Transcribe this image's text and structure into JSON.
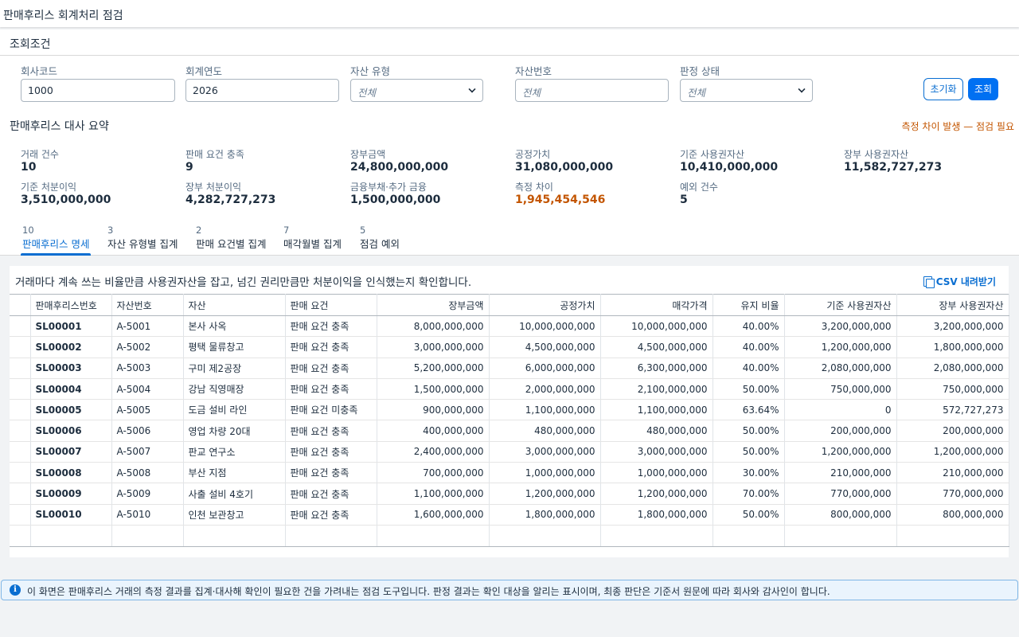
{
  "app": {
    "title": "판매후리스 회계처리 점검"
  },
  "filters": {
    "section_title": "조회조건",
    "company_code": {
      "label": "회사코드",
      "value": "1000"
    },
    "fiscal_year": {
      "label": "회계연도",
      "value": "2026"
    },
    "asset_type": {
      "label": "자산 유형",
      "value": "전체"
    },
    "asset_no": {
      "label": "자산번호",
      "placeholder": "전체"
    },
    "judgement": {
      "label": "판정 상태",
      "value": "전체"
    },
    "reset_label": "초기화",
    "search_label": "조회"
  },
  "summary": {
    "title": "판매후리스 대사 요약",
    "alert": "측정 차이 발생 — 점검 필요",
    "kpis": {
      "tx_count": {
        "label": "거래 건수",
        "value": "10"
      },
      "sale_met": {
        "label": "판매 요건 충족",
        "value": "9"
      },
      "carrying": {
        "label": "장부금액",
        "value": "24,800,000,000"
      },
      "fair_value": {
        "label": "공정가치",
        "value": "31,080,000,000"
      },
      "ref_rou": {
        "label": "기준 사용권자산",
        "value": "10,410,000,000"
      },
      "book_rou": {
        "label": "장부 사용권자산",
        "value": "11,582,727,273"
      },
      "ref_gain": {
        "label": "기준 처분이익",
        "value": "3,510,000,000"
      },
      "book_gain": {
        "label": "장부 처분이익",
        "value": "4,282,727,273"
      },
      "fin_liab": {
        "label": "금융부채·추가 금융",
        "value": "1,500,000,000"
      },
      "diff": {
        "label": "측정 차이",
        "value": "1,945,454,546"
      },
      "exceptions": {
        "label": "예외 건수",
        "value": "5"
      }
    }
  },
  "tabs": [
    {
      "count": "10",
      "label": "판매후리스 명세"
    },
    {
      "count": "3",
      "label": "자산 유형별 집계"
    },
    {
      "count": "2",
      "label": "판매 요건별 집계"
    },
    {
      "count": "7",
      "label": "매각월별 집계"
    },
    {
      "count": "5",
      "label": "점검 예외"
    }
  ],
  "table": {
    "caption": "거래마다 계속 쓰는 비율만큼 사용권자산을 잡고, 넘긴 권리만큼만 처분이익을 인식했는지 확인합니다.",
    "csv_label": "CSV 내려받기",
    "columns": [
      "판매후리스번호",
      "자산번호",
      "자산",
      "판매 요건",
      "장부금액",
      "공정가치",
      "매각가격",
      "유지 비율",
      "기준 사용권자산",
      "장부 사용권자산"
    ],
    "rows": [
      [
        "SL00001",
        "A-5001",
        "본사 사옥",
        "판매 요건 충족",
        "8,000,000,000",
        "10,000,000,000",
        "10,000,000,000",
        "40.00%",
        "3,200,000,000",
        "3,200,000,000"
      ],
      [
        "SL00002",
        "A-5002",
        "평택 물류창고",
        "판매 요건 충족",
        "3,000,000,000",
        "4,500,000,000",
        "4,500,000,000",
        "40.00%",
        "1,200,000,000",
        "1,800,000,000"
      ],
      [
        "SL00003",
        "A-5003",
        "구미 제2공장",
        "판매 요건 충족",
        "5,200,000,000",
        "6,000,000,000",
        "6,300,000,000",
        "40.00%",
        "2,080,000,000",
        "2,080,000,000"
      ],
      [
        "SL00004",
        "A-5004",
        "강남 직영매장",
        "판매 요건 충족",
        "1,500,000,000",
        "2,000,000,000",
        "2,100,000,000",
        "50.00%",
        "750,000,000",
        "750,000,000"
      ],
      [
        "SL00005",
        "A-5005",
        "도금 설비 라인",
        "판매 요건 미충족",
        "900,000,000",
        "1,100,000,000",
        "1,100,000,000",
        "63.64%",
        "0",
        "572,727,273"
      ],
      [
        "SL00006",
        "A-5006",
        "영업 차량 20대",
        "판매 요건 충족",
        "400,000,000",
        "480,000,000",
        "480,000,000",
        "50.00%",
        "200,000,000",
        "200,000,000"
      ],
      [
        "SL00007",
        "A-5007",
        "판교 연구소",
        "판매 요건 충족",
        "2,400,000,000",
        "3,000,000,000",
        "3,000,000,000",
        "50.00%",
        "1,200,000,000",
        "1,200,000,000"
      ],
      [
        "SL00008",
        "A-5008",
        "부산 지점",
        "판매 요건 충족",
        "700,000,000",
        "1,000,000,000",
        "1,000,000,000",
        "30.00%",
        "210,000,000",
        "210,000,000"
      ],
      [
        "SL00009",
        "A-5009",
        "사출 설비 4호기",
        "판매 요건 충족",
        "1,100,000,000",
        "1,200,000,000",
        "1,200,000,000",
        "70.00%",
        "770,000,000",
        "770,000,000"
      ],
      [
        "SL00010",
        "A-5010",
        "인천 보관창고",
        "판매 요건 충족",
        "1,600,000,000",
        "1,800,000,000",
        "1,800,000,000",
        "50.00%",
        "800,000,000",
        "800,000,000"
      ]
    ]
  },
  "footer": {
    "note": "이 화면은 판매후리스 거래의 측정 결과를 집계·대사해 확인이 필요한 건을 가려내는 점검 도구입니다. 판정 결과는 확인 대상을 알리는 표시이며, 최종 판단은 기준서 원문에 따라 회사와 감사인이 합니다."
  },
  "colors": {
    "accent": "#0a6ed1",
    "warning": "#c35500"
  },
  "icons": {
    "csv": "copy-icon",
    "info": "info-icon",
    "dropdown": "chevron-down-icon"
  }
}
